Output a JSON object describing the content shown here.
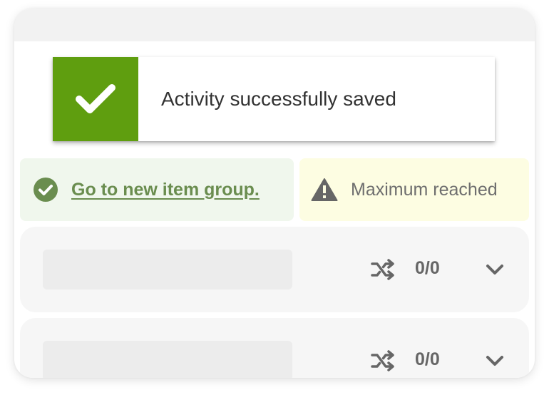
{
  "toast": {
    "message": "Activity successfully saved",
    "icon": "checkmark-icon",
    "color": "#5f9e0f"
  },
  "success_notice": {
    "link_text": "Go to new item group.",
    "icon": "check-circle-icon",
    "background": "#f0f7ed",
    "color": "#6a8d4f"
  },
  "warning_notice": {
    "text": "Maximum reached",
    "icon": "warning-triangle-icon",
    "background": "#fdfde2"
  },
  "item_groups": [
    {
      "count": "0/0",
      "icons": [
        "shuffle-icon",
        "chevron-down-icon"
      ]
    },
    {
      "count": "0/0",
      "icons": [
        "shuffle-icon",
        "chevron-down-icon"
      ]
    }
  ]
}
